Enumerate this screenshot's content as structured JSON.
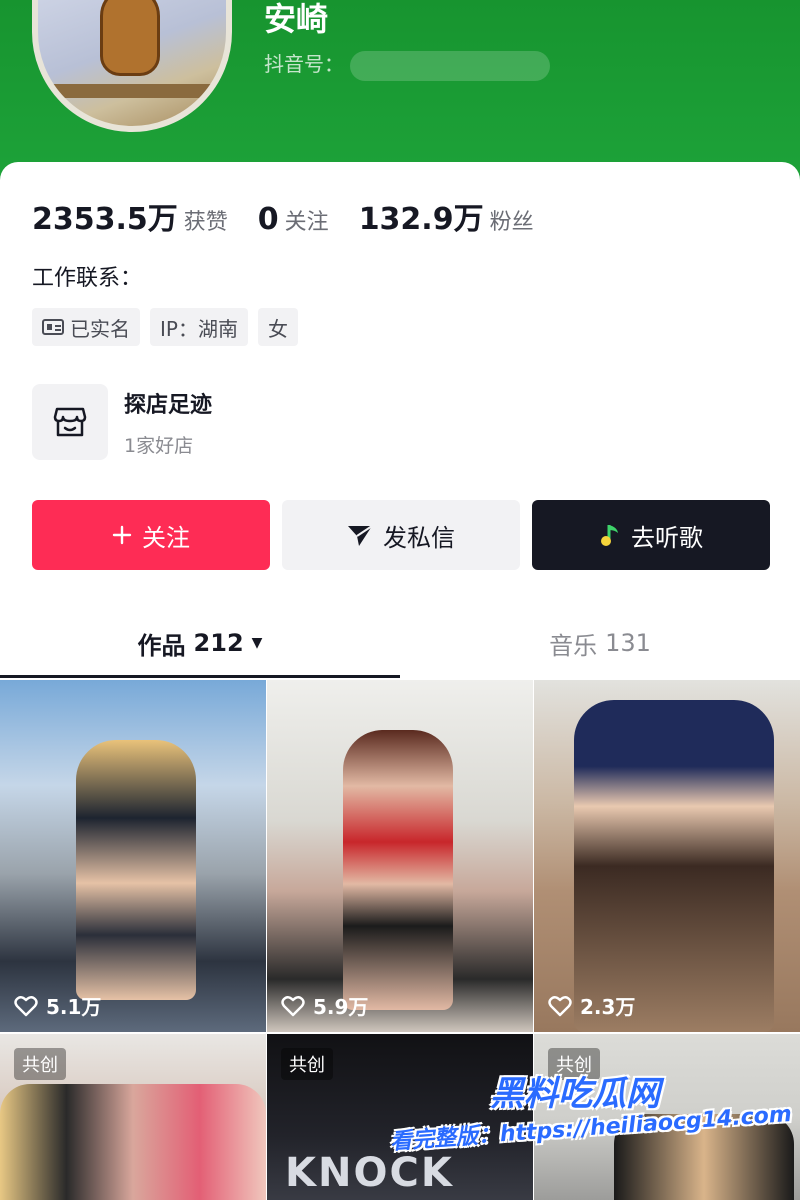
{
  "profile": {
    "username": "安崎",
    "douyin_id_label": "抖音号：",
    "avatar_alt": "avatar"
  },
  "stats": [
    {
      "value": "2353.5万",
      "label": "获赞"
    },
    {
      "value": "0",
      "label": "关注"
    },
    {
      "value": "132.9万",
      "label": "粉丝"
    }
  ],
  "work_contact_label": "工作联系：",
  "tags": [
    {
      "label": "已实名",
      "icon": "id-card-icon"
    },
    {
      "label": "IP：湖南",
      "icon": ""
    },
    {
      "label": "女",
      "icon": ""
    }
  ],
  "shop": {
    "title": "探店足迹",
    "subtitle": "1家好店",
    "icon": "storefront-icon"
  },
  "actions": {
    "follow_label": "关注",
    "message_label": "发私信",
    "music_label": "去听歌",
    "follow_icon": "plus-icon",
    "message_icon": "paper-plane-icon",
    "music_icon": "music-note-icon"
  },
  "tabs": {
    "works_label": "作品",
    "works_count": "212",
    "music_label": "音乐",
    "music_count": "131"
  },
  "videos": [
    {
      "likes": "5.1万",
      "badge": ""
    },
    {
      "likes": "5.9万",
      "badge": ""
    },
    {
      "likes": "2.3万",
      "badge": ""
    },
    {
      "likes": "",
      "badge": "共创"
    },
    {
      "likes": "",
      "badge": "共创",
      "overlay_text": "KNOCK"
    },
    {
      "likes": "",
      "badge": "共创"
    }
  ],
  "watermark": {
    "title": "黑料吃瓜网",
    "url": "看完整版：https://heiliaocg14.com"
  },
  "colors": {
    "header_green": "#1ea43a",
    "follow_red": "#fe2c55",
    "dark_button": "#161823",
    "watermark_blue": "#2a6bff"
  }
}
